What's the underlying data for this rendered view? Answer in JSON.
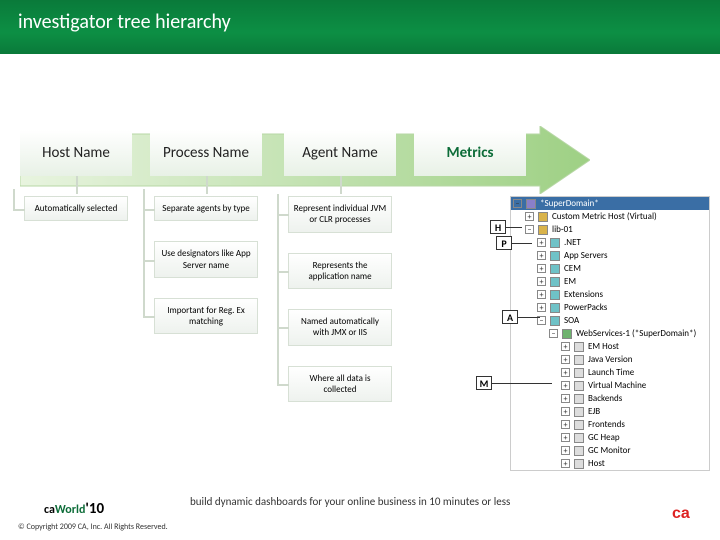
{
  "title": "investigator tree hierarchy",
  "columns": {
    "c0": {
      "header": "Host Name",
      "children": [
        "Automatically selected"
      ]
    },
    "c1": {
      "header": "Process Name",
      "children": [
        "Separate agents by type",
        "Use designators like App Server name",
        "Important for Reg. Ex matching"
      ]
    },
    "c2": {
      "header": "Agent Name",
      "children": [
        "Represent individual JVM or CLR processes",
        "Represents the application name",
        "Named automatically with JMX or IIS",
        "Where all data is collected"
      ]
    },
    "c3": {
      "header": "Metrics"
    }
  },
  "tree": {
    "root": "*SuperDomain*",
    "l1": "Custom Metric Host (Virtual)",
    "l2": "lib-01",
    "l2_children": [
      ".NET",
      "App Servers",
      "CEM",
      "EM",
      "Extensions",
      "PowerPacks",
      "SOA"
    ],
    "l3": "WebServices-1 (*SuperDomain*)",
    "l3_children": [
      "EM Host",
      "Java Version",
      "Launch Time",
      "Virtual Machine",
      "Backends",
      "EJB",
      "Frontends",
      "GC Heap",
      "GC Monitor",
      "Host"
    ]
  },
  "tags": {
    "h": "H",
    "p": "P",
    "a": "A",
    "m": "M"
  },
  "footer": {
    "tagline": "build dynamic dashboards for your online business in 10 minutes or less",
    "copyright": "© Copyright 2009 CA, Inc. All Rights Reserved.",
    "logo_ca": "ca",
    "logo_world_a": "World",
    "logo_world_b": "'10"
  }
}
